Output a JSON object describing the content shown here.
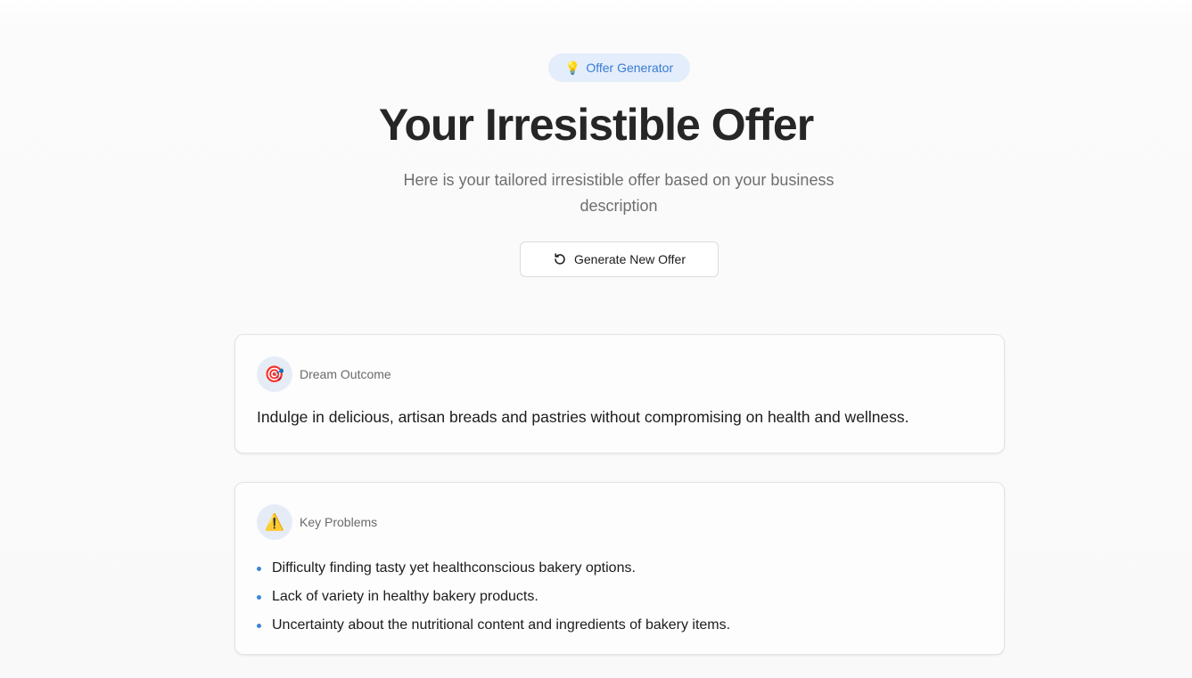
{
  "badge": {
    "icon": "lightbulb-icon",
    "label": "Offer Generator"
  },
  "header": {
    "title": "Your Irresistible Offer",
    "subtitle": "Here is your tailored irresistible offer based on your business description"
  },
  "actions": {
    "generate_label": "Generate New Offer",
    "generate_icon": "refresh-icon"
  },
  "dream_outcome": {
    "icon": "target-icon",
    "label": "Dream Outcome",
    "text": "Indulge in delicious, artisan breads and pastries without compromising on health and wellness."
  },
  "key_problems": {
    "icon": "warning-icon",
    "label": "Key Problems",
    "items": [
      "Difficulty finding tasty yet healthconscious bakery options.",
      "Lack of variety in healthy bakery products.",
      "Uncertainty about the nutritional content and ingredients of bakery items."
    ]
  },
  "colors": {
    "accent": "#3a7bd5",
    "badge_bg": "#e3edfb",
    "bullet": "#3a86d8"
  }
}
